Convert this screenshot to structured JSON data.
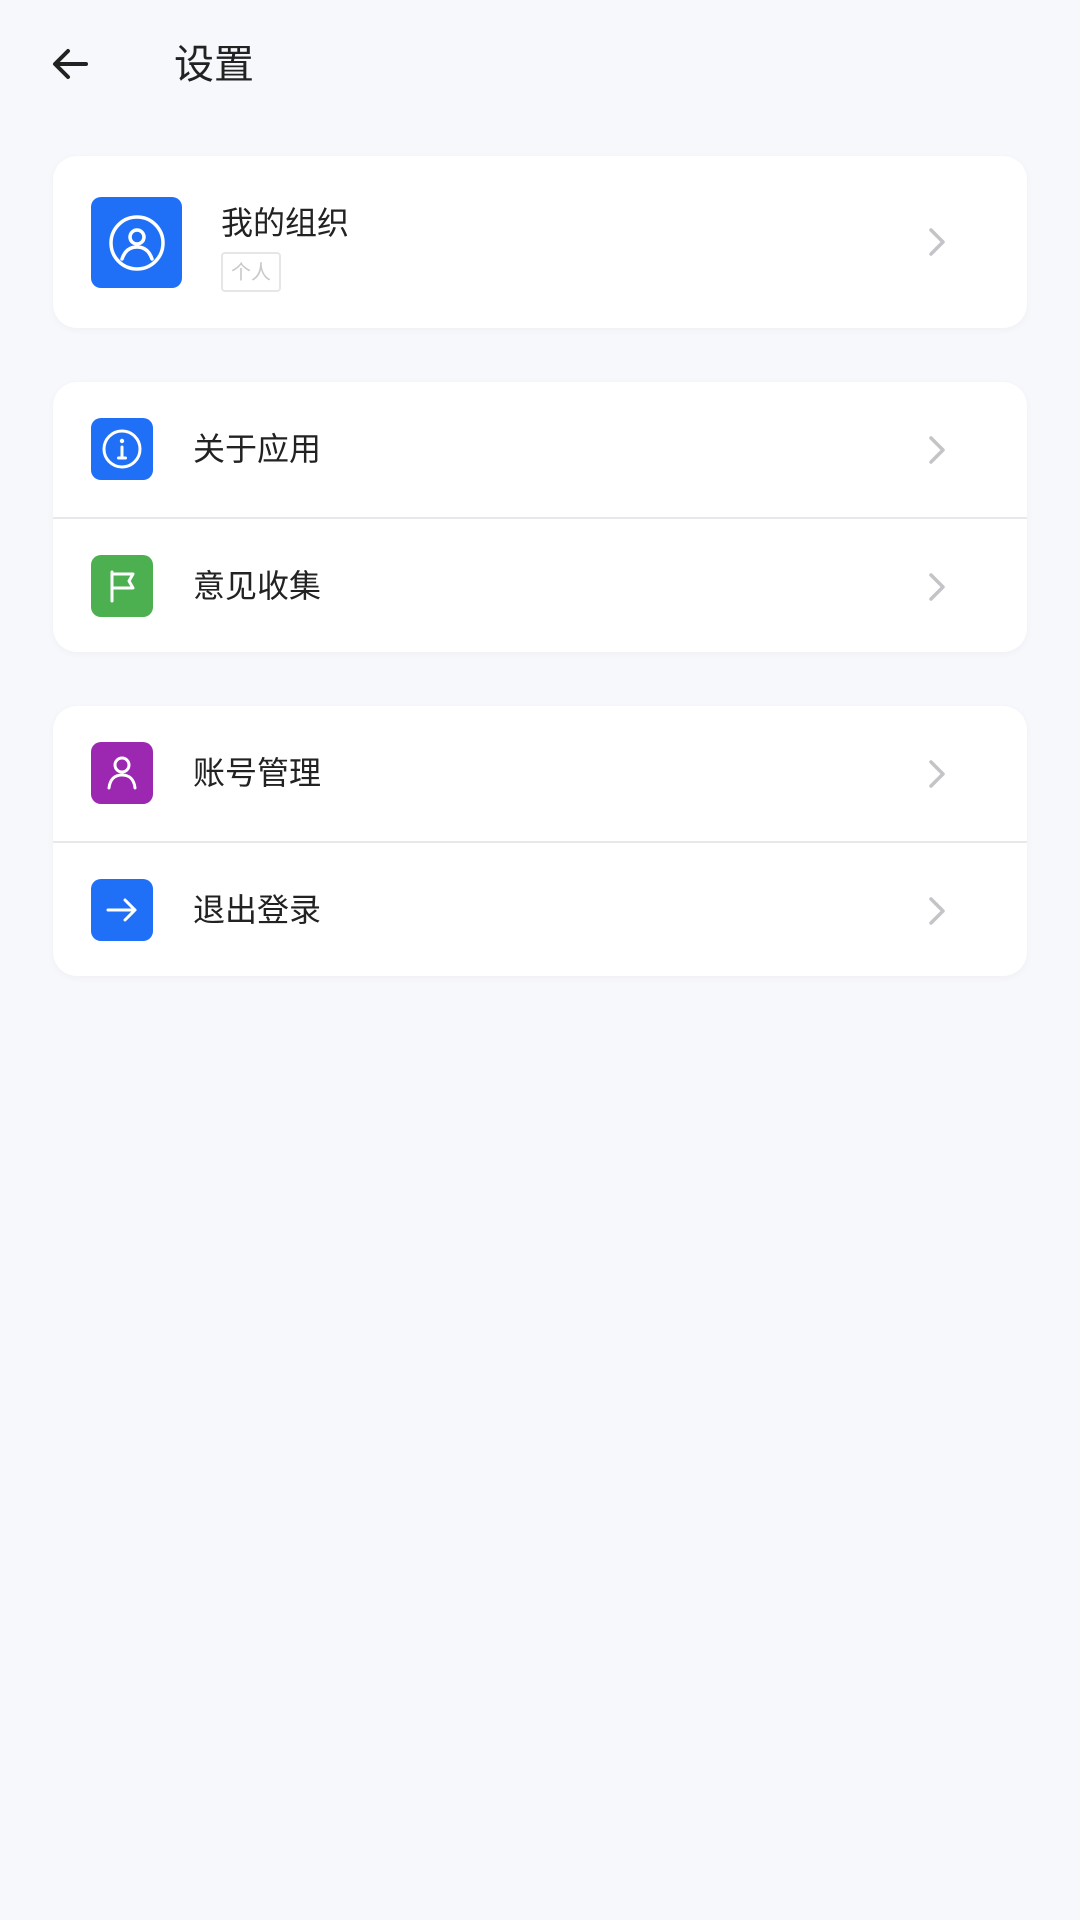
{
  "header": {
    "title": "设置",
    "back_icon": "arrow-left-icon"
  },
  "organization": {
    "name": "我的组织",
    "tag": "个人",
    "icon": "user-circle-icon",
    "icon_color": "#1f6ff7"
  },
  "menu_group_1": {
    "items": [
      {
        "label": "关于应用",
        "icon": "info-icon",
        "icon_color": "#1f6ff7"
      },
      {
        "label": "意见收集",
        "icon": "flag-icon",
        "icon_color": "#4caf50"
      }
    ]
  },
  "menu_group_2": {
    "items": [
      {
        "label": "账号管理",
        "icon": "user-icon",
        "icon_color": "#9c27b0"
      },
      {
        "label": "退出登录",
        "icon": "arrow-right-icon",
        "icon_color": "#1f6ff7"
      }
    ]
  },
  "colors": {
    "background": "#f7f8fc",
    "card": "#ffffff",
    "chevron": "#c4c4c8",
    "text_primary": "#222222"
  }
}
